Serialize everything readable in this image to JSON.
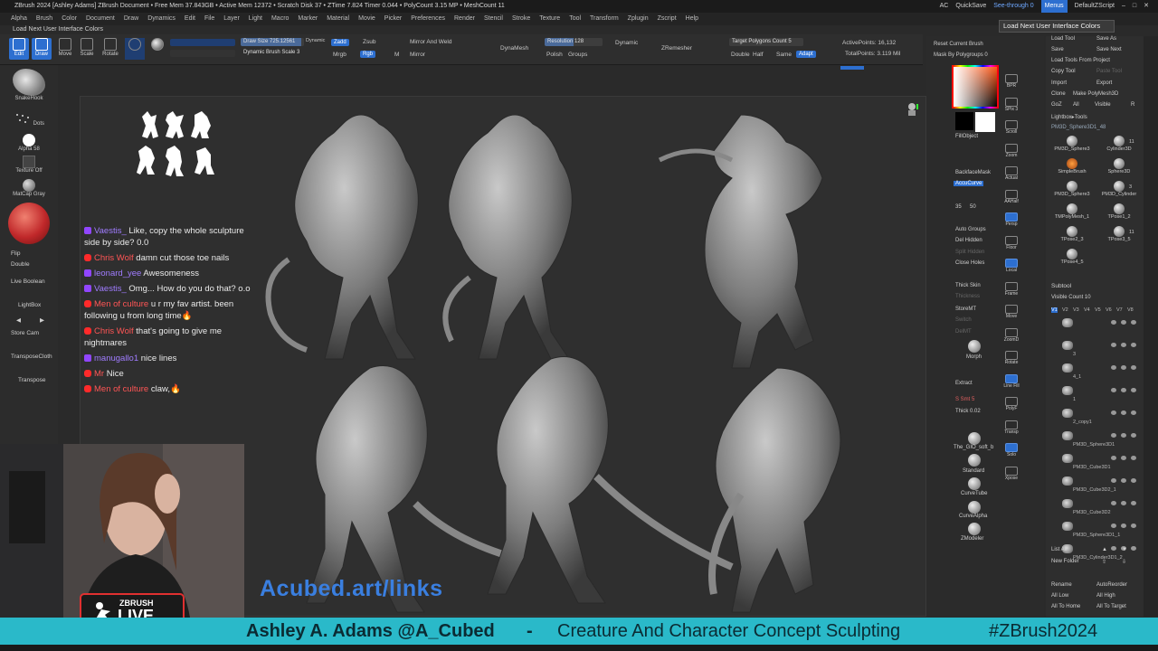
{
  "titlebar": {
    "text": "ZBrush 2024 [Ashley Adams]   ZBrush Document   • Free Mem 37.843GB • Active Mem 12372 • Scratch Disk 37 • ZTime 7.824 Timer 0.044 • PolyCount 3.15 MP • MeshCount 11",
    "ac": "AC",
    "quicksave": "QuickSave",
    "seethrough": "See-through  0",
    "menus": "Menus",
    "script": "DefaultZScript"
  },
  "menubar": [
    "Alpha",
    "Brush",
    "Color",
    "Document",
    "Draw",
    "Dynamics",
    "Edit",
    "File",
    "Layer",
    "Light",
    "Macro",
    "Marker",
    "Material",
    "Movie",
    "Picker",
    "Preferences",
    "Render",
    "Stencil",
    "Stroke",
    "Texture",
    "Tool",
    "Transform",
    "Zplugin",
    "Zscript",
    "Help"
  ],
  "hint": "Load Next User Interface Colors",
  "tooltip": "Load Next User Interface Colors",
  "shelf": {
    "buttons": [
      "Edit",
      "Draw",
      "Move",
      "Scale",
      "Rotate"
    ],
    "mrgb": "Mrgb",
    "rgb": "Rgb",
    "m": "M",
    "zadd": "Zadd",
    "zsub": "Zsub",
    "draw_size_label": "Draw Size 725.12561",
    "draw_size_fill": 0.95,
    "dynamic": "Dynamic",
    "dyn_subdiv": "Dynamic Brush Scale 3",
    "mirror_weld": "Mirror And Weld",
    "mirror": "Mirror",
    "dynamesh": "DynaMesh",
    "resolution": "Resolution 128",
    "resolution_fill": 0.5,
    "polish": "Polish",
    "groups": "Groups",
    "dynamic2": "Dynamic",
    "zremesher": "ZRemesher",
    "target_polys": "Target Polygons Count 5",
    "double": "Double",
    "half": "Half",
    "same": "Same",
    "adapt": "Adapt",
    "active_points": "ActivePoints: 16,132",
    "total_points": "TotalPoints: 3.119 Mil",
    "reset_brush": "Reset Current Brush",
    "mask_by_polygroups": "Mask By Polygroups 0"
  },
  "lefttray": {
    "brush": "SnakeHook",
    "stroke": "Dots",
    "alpha": "Alpha 58",
    "texture": "Texture Off",
    "material": "MatCap Gray",
    "flip": "Flip",
    "double": "Double",
    "live_boolean": "Live Boolean",
    "lightbox": "LightBox",
    "store_cam": "Store Cam",
    "transpose_cloth": "TransposeCloth",
    "transpose": "Transpose"
  },
  "chat": [
    {
      "platform": "twitch",
      "user": "Vaestis_",
      "text": "Like, copy the whole sculpture side by side? 0.0"
    },
    {
      "platform": "youtube",
      "user": "Chris Wolf",
      "text": "damn cut those toe nails"
    },
    {
      "platform": "twitch",
      "user": "leonard_yee",
      "text": "Awesomeness"
    },
    {
      "platform": "twitch",
      "user": "Vaestis_",
      "text": "Omg... How do you do that? o.o"
    },
    {
      "platform": "youtube",
      "user": "Men of culture",
      "text": "u r my fav artist. been following u from long time🔥"
    },
    {
      "platform": "youtube",
      "user": "Chris Wolf",
      "text": "that's going to give me nightmares"
    },
    {
      "platform": "twitch",
      "user": "manugallo1",
      "text": "nice lines"
    },
    {
      "platform": "youtube",
      "user": "Mr",
      "text": "Nice"
    },
    {
      "platform": "youtube",
      "user": "Men of culture",
      "text": "claw,🔥"
    }
  ],
  "overlay_link": "Acubed.art/links",
  "zlive": {
    "zbrush": "ZBRUSH",
    "live": "LIVE"
  },
  "banner": {
    "name": "Ashley A. Adams @A_Cubed",
    "sep": "-",
    "title": "Creature And Character Concept Sculpting",
    "tag": "#ZBrush2024"
  },
  "righttray": {
    "items": [
      "BPR",
      "SPix 3",
      "Scroll",
      "Zoom",
      "Actual",
      "AAHalf",
      "Persp",
      "Floor",
      "Local",
      "Frame",
      "Move",
      "ZoomD",
      "Rotate",
      "Line Fill",
      "PolyF",
      "Transp",
      "Solo",
      "Xpose"
    ],
    "fill_object": "FillObject",
    "backface_mask": "BackfaceMask",
    "accucurve": "AccuCurve",
    "size_35": "35",
    "size_50": "50",
    "auto_groups": "Auto Groups",
    "del_hidden": "Del Hidden",
    "split_hidden": "Split Hidden",
    "close_holes": "Close Holes",
    "thick_skin": "Thick Skin",
    "thickness": "Thickness",
    "store_mt": "StoreMT",
    "switch": "Switch",
    "del_mt": "DelMT",
    "morph": "Morph",
    "extract": "Extract",
    "s_smt": "S Smt 5",
    "thick": "Thick 0.02",
    "clo_soft": "The_GIO_soft_b",
    "standard": "Standard",
    "curve_tube": "CurveTube",
    "curve_alpha": "CurveAlpha",
    "zmodeler": "ZModeler"
  },
  "tooltray": {
    "load_tool": "Load Tool",
    "save_as": "Save As",
    "save": "Save",
    "save_next": "Save Next",
    "load_from_project": "Load Tools From Project",
    "copy_tool": "Copy Tool",
    "paste_tool": "Paste Tool",
    "import": "Import",
    "export": "Export",
    "clone": "Clone",
    "make_polymesh": "Make PolyMesh3D",
    "goz": "GoZ",
    "all": "All",
    "visible": "Visible",
    "r": "R",
    "lightbox_tools": "Lightbox▸Tools",
    "current_tool": "PM3D_Sphere3D1_48",
    "tools": [
      "PM3D_Sphere3",
      "Cylinder3D",
      "SimpleBrush",
      "Sphere3D",
      "PM3D_Sphere3",
      "PM3D_Cylinder",
      "TMPolyMesh_1",
      "TPose1_2",
      "TPose2_3",
      "TPose3_5",
      "TPose4_5"
    ],
    "tool_counts": [
      "11",
      "3",
      "11"
    ],
    "subtool": "Subtool",
    "visible_count": "Visible Count 10",
    "subtool_tabs": [
      "V1",
      "V2",
      "V3",
      "V4",
      "V5",
      "V6",
      "V7",
      "V8"
    ],
    "subtools": [
      "",
      "3",
      "4_1",
      "1",
      "2_copy1",
      "PM3D_Sphere3D1",
      "PM3D_Cube3D1",
      "PM3D_Cube3D2_1",
      "PM3D_Cube3D2",
      "PM3D_Sphere3D1_1",
      "PM3D_Cylinder3D1_2"
    ],
    "list_all": "List All",
    "new_folder": "New Folder",
    "rename": "Rename",
    "auto_reorder": "AutoReorder",
    "all_low": "All Low",
    "all_high": "All High",
    "all_to_home": "All To Home",
    "all_to_target": "All To Target"
  }
}
